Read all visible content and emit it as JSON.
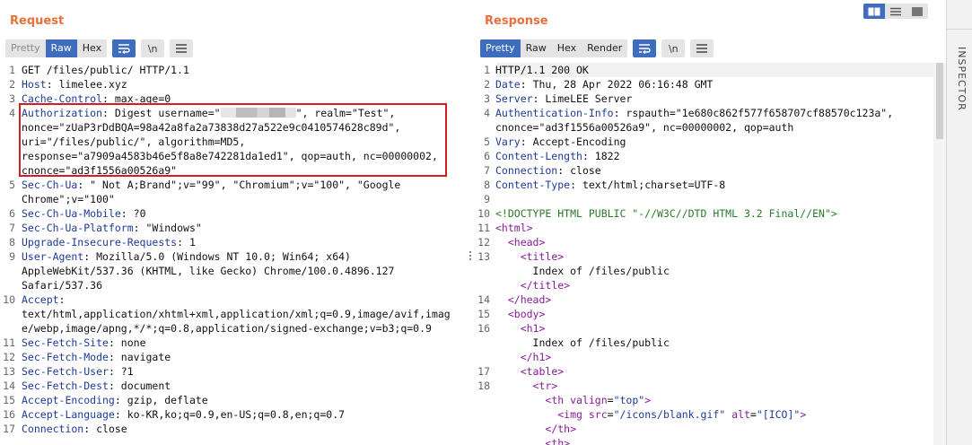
{
  "request": {
    "title": "Request",
    "tabs": [
      "Pretty",
      "Raw",
      "Hex"
    ],
    "icons": [
      "wrap-icon",
      "newline-icon",
      "menu-icon"
    ],
    "newline_label": "\\n",
    "lines": [
      {
        "n": "1",
        "key": "",
        "val": "GET /files/public/ HTTP/1.1"
      },
      {
        "n": "2",
        "key": "Host",
        "val": "limelee.xyz"
      },
      {
        "n": "3",
        "key": "Cache-Control",
        "val": "max-age=0"
      },
      {
        "n": "4",
        "key": "Authorization",
        "val": "Digest username=\"",
        "redacted": true,
        "after": "\", realm=\"Test\","
      },
      {
        "n": "",
        "key": "",
        "val": "nonce=\"zUaP3rDdBQA=98a42a8fa2a73838d27a522e9c0410574628c89d\","
      },
      {
        "n": "",
        "key": "",
        "val": "uri=\"/files/public/\", algorithm=MD5,"
      },
      {
        "n": "",
        "key": "",
        "val": "response=\"a7909a4583b46e5f8a8e742281da1ed1\", qop=auth, nc=00000002,"
      },
      {
        "n": "",
        "key": "",
        "val": "cnonce=\"ad3f1556a00526a9\""
      },
      {
        "n": "5",
        "key": "Sec-Ch-Ua",
        "val": "\" Not A;Brand\";v=\"99\", \"Chromium\";v=\"100\", \"Google"
      },
      {
        "n": "",
        "key": "",
        "val": "Chrome\";v=\"100\""
      },
      {
        "n": "6",
        "key": "Sec-Ch-Ua-Mobile",
        "val": "?0"
      },
      {
        "n": "7",
        "key": "Sec-Ch-Ua-Platform",
        "val": "\"Windows\""
      },
      {
        "n": "8",
        "key": "Upgrade-Insecure-Requests",
        "val": "1"
      },
      {
        "n": "9",
        "key": "User-Agent",
        "val": "Mozilla/5.0 (Windows NT 10.0; Win64; x64)"
      },
      {
        "n": "",
        "key": "",
        "val": "AppleWebKit/537.36 (KHTML, like Gecko) Chrome/100.0.4896.127"
      },
      {
        "n": "",
        "key": "",
        "val": "Safari/537.36"
      },
      {
        "n": "10",
        "key": "Accept",
        "val": ""
      },
      {
        "n": "",
        "key": "",
        "val": "text/html,application/xhtml+xml,application/xml;q=0.9,image/avif,imag"
      },
      {
        "n": "",
        "key": "",
        "val": "e/webp,image/apng,*/*;q=0.8,application/signed-exchange;v=b3;q=0.9"
      },
      {
        "n": "11",
        "key": "Sec-Fetch-Site",
        "val": "none"
      },
      {
        "n": "12",
        "key": "Sec-Fetch-Mode",
        "val": "navigate"
      },
      {
        "n": "13",
        "key": "Sec-Fetch-User",
        "val": "?1"
      },
      {
        "n": "14",
        "key": "Sec-Fetch-Dest",
        "val": "document"
      },
      {
        "n": "15",
        "key": "Accept-Encoding",
        "val": "gzip, deflate"
      },
      {
        "n": "16",
        "key": "Accept-Language",
        "val": "ko-KR,ko;q=0.9,en-US;q=0.8,en;q=0.7"
      },
      {
        "n": "17",
        "key": "Connection",
        "val": "close"
      }
    ]
  },
  "response": {
    "title": "Response",
    "tabs": [
      "Pretty",
      "Raw",
      "Hex",
      "Render"
    ],
    "newline_label": "\\n",
    "lines": [
      {
        "n": "1",
        "type": "plain",
        "val": "HTTP/1.1 200 OK"
      },
      {
        "n": "2",
        "type": "header",
        "key": "Date",
        "val": "Thu, 28 Apr 2022 06:16:48 GMT"
      },
      {
        "n": "3",
        "type": "header",
        "key": "Server",
        "val": "LimeLEE Server"
      },
      {
        "n": "4",
        "type": "header",
        "key": "Authentication-Info",
        "val": "rspauth=\"1e680c862f577f658707cf88570c123a\","
      },
      {
        "n": "",
        "type": "plain",
        "val": "cnonce=\"ad3f1556a00526a9\", nc=00000002, qop=auth"
      },
      {
        "n": "5",
        "type": "header",
        "key": "Vary",
        "val": "Accept-Encoding"
      },
      {
        "n": "6",
        "type": "header",
        "key": "Content-Length",
        "val": "1822"
      },
      {
        "n": "7",
        "type": "header",
        "key": "Connection",
        "val": "close"
      },
      {
        "n": "8",
        "type": "header",
        "key": "Content-Type",
        "val": "text/html;charset=UTF-8"
      },
      {
        "n": "9",
        "type": "plain",
        "val": ""
      },
      {
        "n": "10",
        "type": "doctype",
        "val": "<!DOCTYPE HTML PUBLIC \"-//W3C//DTD HTML 3.2 Final//EN\">"
      },
      {
        "n": "11",
        "type": "tag",
        "indent": "",
        "val": "<html>"
      },
      {
        "n": "12",
        "type": "tag",
        "indent": "  ",
        "val": "<head>"
      },
      {
        "n": "13",
        "type": "tag",
        "indent": "    ",
        "val": "<title>"
      },
      {
        "n": "",
        "type": "plain",
        "indent": "      ",
        "val": "Index of /files/public"
      },
      {
        "n": "",
        "type": "tag",
        "indent": "    ",
        "val": "</title>"
      },
      {
        "n": "14",
        "type": "tag",
        "indent": "  ",
        "val": "</head>"
      },
      {
        "n": "15",
        "type": "tag",
        "indent": "  ",
        "val": "<body>"
      },
      {
        "n": "16",
        "type": "tag",
        "indent": "    ",
        "val": "<h1>"
      },
      {
        "n": "",
        "type": "plain",
        "indent": "      ",
        "val": "Index of /files/public"
      },
      {
        "n": "",
        "type": "tag",
        "indent": "    ",
        "val": "</h1>"
      },
      {
        "n": "17",
        "type": "tag",
        "indent": "    ",
        "val": "<table>"
      },
      {
        "n": "18",
        "type": "tag",
        "indent": "      ",
        "val": "<tr>"
      },
      {
        "n": "",
        "type": "elem",
        "indent": "        ",
        "tag": "th",
        "attrs": [
          [
            "valign",
            "top"
          ]
        ]
      },
      {
        "n": "",
        "type": "elem",
        "indent": "          ",
        "tag": "img",
        "attrs": [
          [
            "src",
            "/icons/blank.gif"
          ],
          [
            "alt",
            "[ICO]"
          ]
        ]
      },
      {
        "n": "",
        "type": "tag",
        "indent": "        ",
        "val": "</th>"
      },
      {
        "n": "",
        "type": "tag",
        "indent": "        ",
        "val": "<th>"
      }
    ]
  },
  "inspector": {
    "label": "INSPECTOR"
  },
  "colors": {
    "accent": "#e8703a",
    "active_button": "#3e6dbd",
    "highlight_box": "#d11f25",
    "header_key": "#1e3a9a",
    "tag": "#8a1a9a",
    "doctype": "#2a7a2a"
  }
}
